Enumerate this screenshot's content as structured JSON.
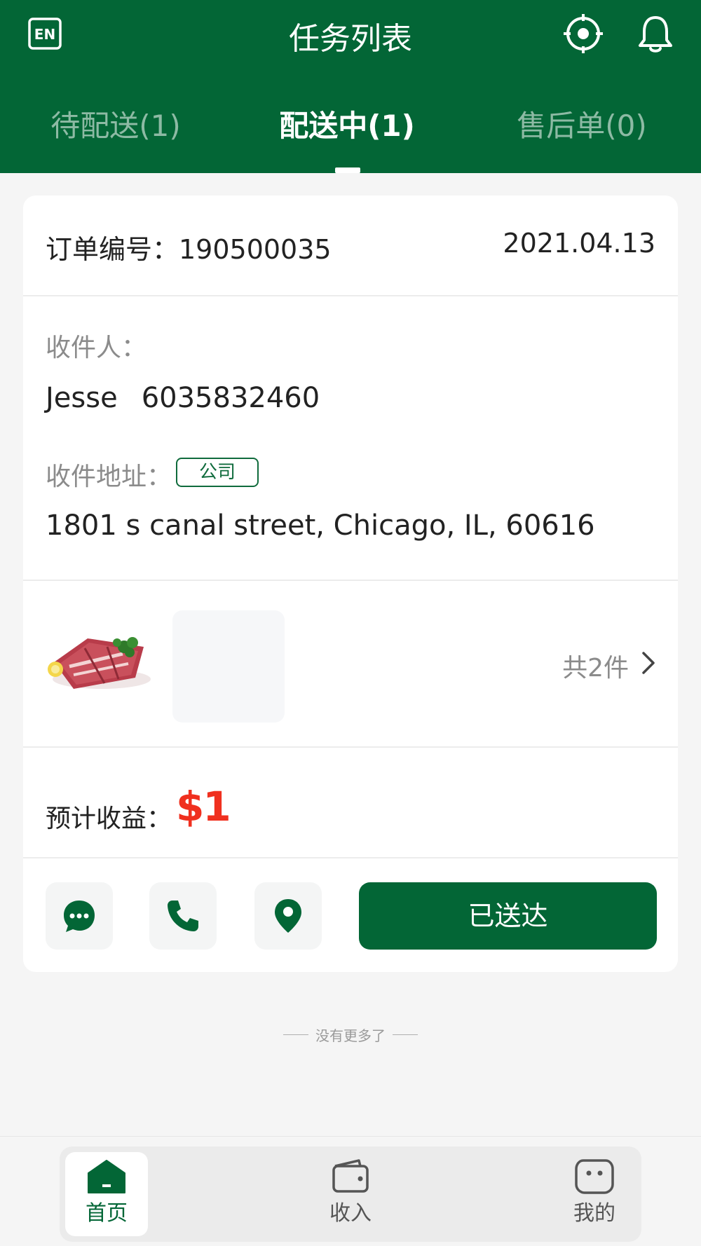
{
  "header": {
    "title": "任务列表",
    "lang_icon": "en-language-icon",
    "locate_icon": "locate-target-icon",
    "bell_icon": "bell-icon"
  },
  "tabs": [
    {
      "label": "待配送(1)",
      "active": false
    },
    {
      "label": "配送中(1)",
      "active": true
    },
    {
      "label": "售后单(0)",
      "active": false
    }
  ],
  "order": {
    "number_label": "订单编号：190500035",
    "date": "2021.04.13",
    "recipient_label": "收件人：",
    "recipient_name": "Jesse",
    "recipient_phone": "6035832460",
    "address_label": "收件地址：",
    "address_tag": "公司",
    "address": "1801 s canal street, Chicago, IL, 60616",
    "items_total": "共2件",
    "earnings_label": "预计收益：",
    "earnings_value": "$1",
    "delivered_button": "已送达"
  },
  "footer_note": "没有更多了",
  "bottom_nav": [
    {
      "label": "首页",
      "icon": "home-icon",
      "active": true
    },
    {
      "label": "收入",
      "icon": "wallet-icon",
      "active": false
    },
    {
      "label": "我的",
      "icon": "profile-face-icon",
      "active": false
    }
  ],
  "colors": {
    "brand_green": "#036636",
    "price_red": "#f0301f",
    "background": "#f5f5f5"
  }
}
